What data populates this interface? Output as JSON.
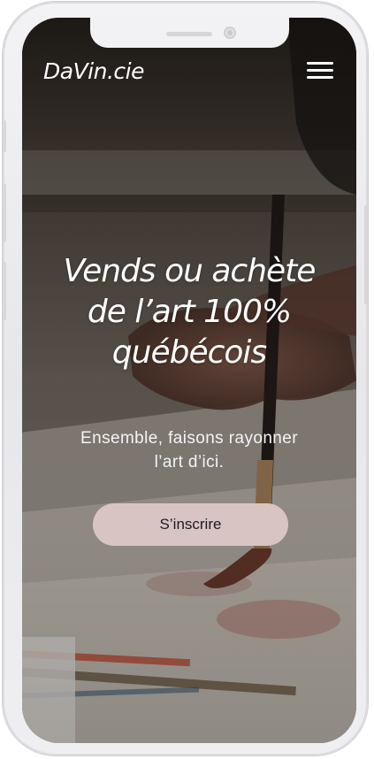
{
  "header": {
    "logo": "DaVin.cie",
    "menu_icon": "hamburger-menu-icon"
  },
  "hero": {
    "headline_line1": "Vends ou achète",
    "headline_line2": "de l’art 100%",
    "headline_line3": "québécois",
    "subtitle_line1": "Ensemble, faisons rayonner",
    "subtitle_line2": "l’art d’ici.",
    "cta_label": "S’inscrire",
    "background_image": "artist-painting-brush-photo"
  },
  "colors": {
    "cta_background": "#d9c4c4",
    "text": "#ffffff",
    "device_frame": "#ededf0"
  }
}
